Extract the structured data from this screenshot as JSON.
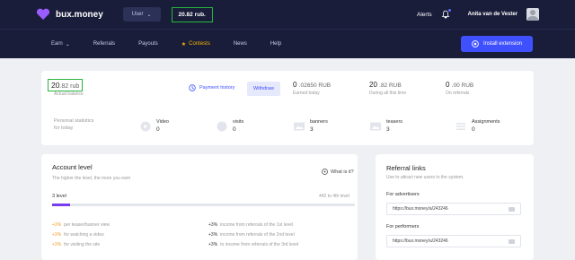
{
  "header": {
    "logo_text": "bux.money",
    "user_dropdown": "User",
    "balance": "20.82 rub.",
    "alerts": "Alerts",
    "username": "Anita van de Vester"
  },
  "nav": {
    "items": [
      "Earn",
      "Referrals",
      "Payouts",
      "Contests",
      "News",
      "Help"
    ],
    "earn_caret": "⌄",
    "install_label": "Install extension"
  },
  "stats": {
    "balance_int": "20",
    "balance_dec": ".82 rub",
    "balance_label": "Actual balance",
    "payment_history": "Payment history",
    "withdraw": "Withdraw",
    "earned_today_int": "0",
    "earned_today_dec": ".02650 RUB",
    "earned_today_label": "Earned today",
    "all_time_int": "20",
    "all_time_dec": ".82 RUB",
    "all_time_label": "During all this time",
    "referrals_int": "0",
    "referrals_dec": ".00 RUB",
    "referrals_label": "On referrals"
  },
  "personal": {
    "label_line1": "Personal statistics",
    "label_line2": "for today",
    "items": [
      {
        "title": "Video",
        "value": "0",
        "icon": "video-icon"
      },
      {
        "title": "visits",
        "value": "0",
        "icon": "visits-icon"
      },
      {
        "title": "banners",
        "value": "3",
        "icon": "banners-icon"
      },
      {
        "title": "teasers",
        "value": "3",
        "icon": "teasers-icon"
      },
      {
        "title": "Assignments",
        "value": "0",
        "icon": "assignments-icon"
      }
    ]
  },
  "account": {
    "title": "Account level",
    "subtitle": "The higher the level, the more you earn",
    "whatis": "What is it?",
    "level": "3 level",
    "next_level": "442 to 4th level",
    "progress": 0.06,
    "bonuses_left": [
      {
        "pct": "+3%",
        "text": "per teaser/banner view"
      },
      {
        "pct": "+3%",
        "text": "for watching a video"
      },
      {
        "pct": "+3%",
        "text": "for visiting the site"
      }
    ],
    "bonuses_right": [
      {
        "pct": "+3%",
        "text": "income from referrals of the 1st level"
      },
      {
        "pct": "+3%",
        "text": "income from referrals of the 2nd level"
      },
      {
        "pct": "+3%",
        "text": "to income from referrals of the 3rd level"
      }
    ]
  },
  "referral": {
    "title": "Referral links",
    "subtitle": "Use to attract new users to the system.",
    "advertisers_label": "For advertisers",
    "advertisers_link": "https://bux.money/a/243246",
    "performers_label": "For performers",
    "performers_link": "https://bux.money/u/243246"
  },
  "colors": {
    "header_bg": "#1a1d3a",
    "accent": "#3f51ff",
    "highlight": "#27b43c",
    "contest": "#f5b400",
    "bonus": "#f29b2b",
    "progress": "#7a3cf0"
  }
}
